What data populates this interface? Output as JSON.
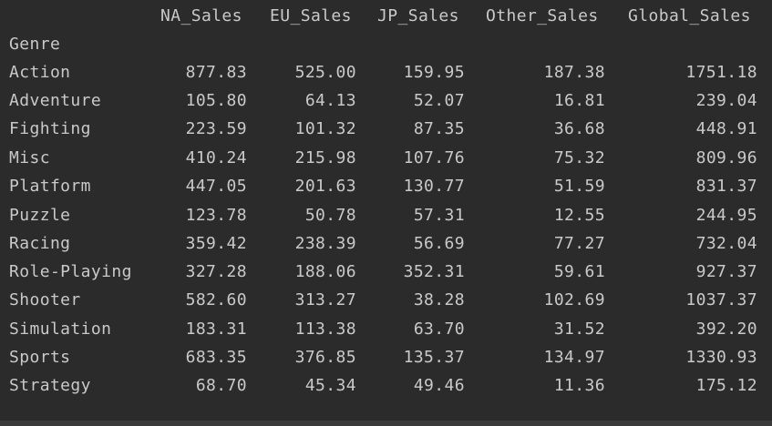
{
  "table": {
    "columns": [
      "NA_Sales",
      "EU_Sales",
      "JP_Sales",
      "Other_Sales",
      "Global_Sales"
    ],
    "index_name": "Genre",
    "rows": [
      {
        "genre": "Action",
        "values": [
          "877.83",
          "525.00",
          "159.95",
          "187.38",
          "1751.18"
        ]
      },
      {
        "genre": "Adventure",
        "values": [
          "105.80",
          "64.13",
          "52.07",
          "16.81",
          "239.04"
        ]
      },
      {
        "genre": "Fighting",
        "values": [
          "223.59",
          "101.32",
          "87.35",
          "36.68",
          "448.91"
        ]
      },
      {
        "genre": "Misc",
        "values": [
          "410.24",
          "215.98",
          "107.76",
          "75.32",
          "809.96"
        ]
      },
      {
        "genre": "Platform",
        "values": [
          "447.05",
          "201.63",
          "130.77",
          "51.59",
          "831.37"
        ]
      },
      {
        "genre": "Puzzle",
        "values": [
          "123.78",
          "50.78",
          "57.31",
          "12.55",
          "244.95"
        ]
      },
      {
        "genre": "Racing",
        "values": [
          "359.42",
          "238.39",
          "56.69",
          "77.27",
          "732.04"
        ]
      },
      {
        "genre": "Role-Playing",
        "values": [
          "327.28",
          "188.06",
          "352.31",
          "59.61",
          "927.37"
        ]
      },
      {
        "genre": "Shooter",
        "values": [
          "582.60",
          "313.27",
          "38.28",
          "102.69",
          "1037.37"
        ]
      },
      {
        "genre": "Simulation",
        "values": [
          "183.31",
          "113.38",
          "63.70",
          "31.52",
          "392.20"
        ]
      },
      {
        "genre": "Sports",
        "values": [
          "683.35",
          "376.85",
          "135.37",
          "134.97",
          "1330.93"
        ]
      },
      {
        "genre": "Strategy",
        "values": [
          "68.70",
          "45.34",
          "49.46",
          "11.36",
          "175.12"
        ]
      }
    ]
  }
}
